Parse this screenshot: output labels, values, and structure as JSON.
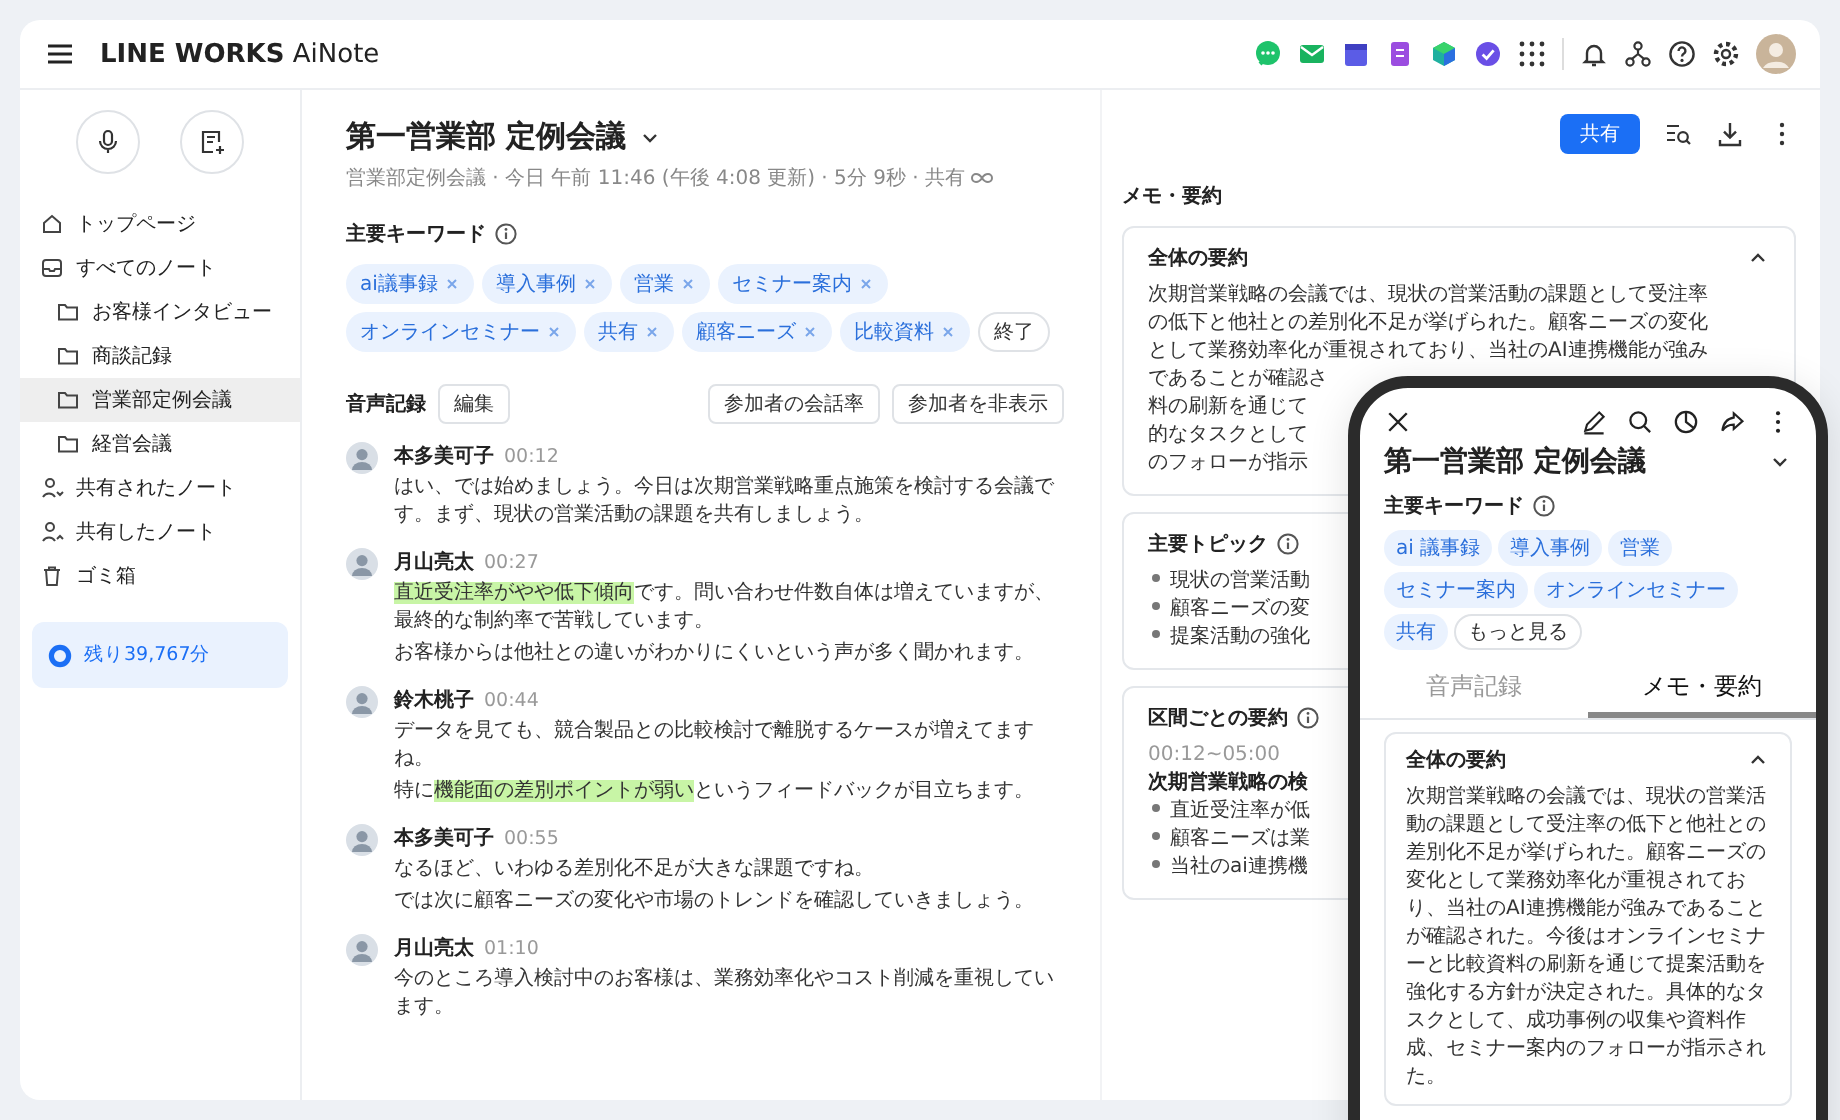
{
  "header": {
    "logo_brand": "LINE WORKS",
    "logo_product": "AiNote"
  },
  "sidebar": {
    "items": [
      {
        "label": "トップページ",
        "kind": "home",
        "selected": false
      },
      {
        "label": "すべてのノート",
        "kind": "notes",
        "selected": false,
        "children": [
          {
            "label": "お客様インタビュー",
            "selected": false
          },
          {
            "label": "商談記録",
            "selected": false
          },
          {
            "label": "営業部定例会議",
            "selected": true
          },
          {
            "label": "経営会議",
            "selected": false
          }
        ]
      },
      {
        "label": "共有されたノート",
        "kind": "shared_in",
        "selected": false
      },
      {
        "label": "共有したノート",
        "kind": "shared_out",
        "selected": false
      },
      {
        "label": "ゴミ箱",
        "kind": "trash",
        "selected": false
      }
    ],
    "remaining": "残り39,767分"
  },
  "note": {
    "title": "第一営業部 定例会議",
    "meta": "営業部定例会議 · 今日 午前 11:46 (午後 4:08 更新) · 5分 9秒 · 共有",
    "share_button": "共有",
    "keywords": {
      "heading": "主要キーワード",
      "chips": [
        "ai議事録",
        "導入事例",
        "営業",
        "セミナー案内",
        "オンラインセミナー",
        "共有",
        "顧客ニーズ",
        "比較資料"
      ],
      "done_button": "終了"
    },
    "transcript": {
      "heading": "音声記録",
      "edit_button": "編集",
      "buttons": [
        "参加者の会話率",
        "参加者を非表示"
      ],
      "utterances": [
        {
          "speaker": "本多美可子",
          "time": "00:12",
          "paragraphs": [
            [
              {
                "text": "はい、では始めましょう。今日は次期営業戦略重点施策を検討する会議です。まず、現状の営業活動の課題を共有しましょう。",
                "highlight": false
              }
            ]
          ]
        },
        {
          "speaker": "月山亮太",
          "time": "00:27",
          "paragraphs": [
            [
              {
                "text": "直近受注率がやや低下傾向",
                "highlight": true
              },
              {
                "text": "です。問い合わせ件数自体は増えていますが、最終的な制約率で苦戦しています。",
                "highlight": false
              }
            ],
            [
              {
                "text": "お客様からは他社との違いがわかりにくいという声が多く聞かれます。",
                "highlight": false
              }
            ]
          ]
        },
        {
          "speaker": "鈴木桃子",
          "time": "00:44",
          "paragraphs": [
            [
              {
                "text": "データを見ても、競合製品との比較検討で離脱するケースが増えてますね。",
                "highlight": false
              }
            ],
            [
              {
                "text": "特に",
                "highlight": false
              },
              {
                "text": "機能面の差別ポイントが弱い",
                "highlight": true
              },
              {
                "text": "というフィードバックが目立ちます。",
                "highlight": false
              }
            ]
          ]
        },
        {
          "speaker": "本多美可子",
          "time": "00:55",
          "paragraphs": [
            [
              {
                "text": "なるほど、いわゆる差別化不足が大きな課題ですね。",
                "highlight": false
              }
            ],
            [
              {
                "text": "では次に顧客ニーズの変化や市場のトレンドを確認していきましょう。",
                "highlight": false
              }
            ]
          ]
        },
        {
          "speaker": "月山亮太",
          "time": "01:10",
          "paragraphs": [
            [
              {
                "text": "今のところ導入検討中のお客様は、業務効率化やコスト削減を重視しています。",
                "highlight": false
              }
            ]
          ]
        }
      ]
    }
  },
  "memo": {
    "heading": "メモ・要約",
    "summary": {
      "title": "全体の要約",
      "expanded": true,
      "lines": [
        "次期営業戦略の会議では、現状の営業活動の課題として受注率",
        "の低下と他社との差別化不足が挙げられた。顧客ニーズの変化",
        "として業務効率化が重視されており、当社のAI連携機能が強み",
        "であることが確認さ",
        "料の刷新を通じて",
        "的なタスクとして",
        "のフォローが指示"
      ]
    },
    "topics": {
      "title": "主要トピック",
      "items": [
        "現状の営業活動",
        "顧客ニーズの変",
        "提案活動の強化"
      ]
    },
    "sections": {
      "title": "区間ごとの要約",
      "range": "00:12~05:00",
      "subtitle": "次期営業戦略の検",
      "items": [
        "直近受注率が低",
        "顧客ニーズは業",
        "当社のai連携機"
      ]
    }
  },
  "phone": {
    "title": "第一営業部 定例会議",
    "keywords_heading": "主要キーワード",
    "chips": [
      "ai 議事録",
      "導入事例",
      "営業",
      "セミナー案内",
      "オンラインセミナー",
      "共有"
    ],
    "more_button": "もっと見る",
    "tabs": [
      {
        "label": "音声記録",
        "selected": false
      },
      {
        "label": "メモ・要約",
        "selected": true
      }
    ],
    "summary": {
      "title": "全体の要約",
      "expanded": true,
      "text": "次期営業戦略の会議では、現状の営業活動の課題として受注率の低下と他社との差別化不足が挙げられた。顧客ニーズの変化として業務効率化が重視されており、当社のAI連携機能が強みであることが確認された。今後はオンラインセミナーと比較資料の刷新を通じて提案活動を強化する方針が決定された。具体的なタスクとして、成功事例の収集や資料作成、セミナー案内のフォローが指示された。"
    }
  }
}
